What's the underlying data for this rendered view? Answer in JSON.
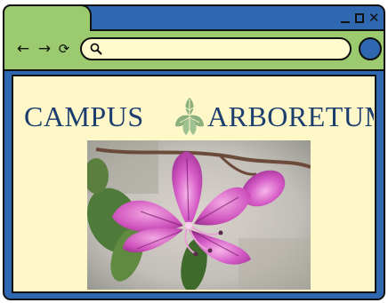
{
  "window": {
    "controls": {
      "minimize": "minimize-icon",
      "maximize": "maximize-icon",
      "close_label": "✕"
    }
  },
  "toolbar": {
    "back_label": "←",
    "forward_label": "→",
    "reload_label": "⟳",
    "address": {
      "value": "",
      "placeholder": ""
    },
    "icons": {
      "search": "search-icon",
      "profile": "profile-icon"
    }
  },
  "page": {
    "logo": {
      "word1": "Campus",
      "word2": "Arboretum",
      "emblem": "leaf-emblem"
    },
    "photo": {
      "alt": ""
    }
  },
  "colors": {
    "frame_blue": "#2f67b0",
    "toolbar_green": "#9ccb6f",
    "viewport_cream": "#fef8c9",
    "logo_navy": "#1c3e6e",
    "logo_green": "#8bb07e"
  }
}
